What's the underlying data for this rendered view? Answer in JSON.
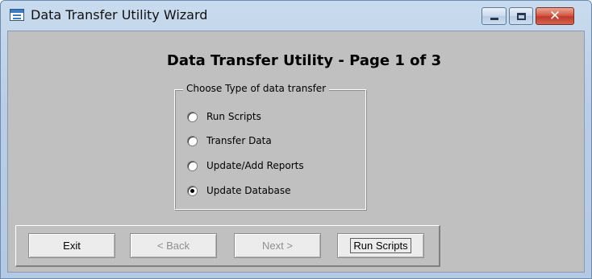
{
  "window": {
    "title": "Data Transfer Utility Wizard",
    "close_symbol": "✕"
  },
  "page": {
    "title": "Data Transfer Utility - Page 1 of 3"
  },
  "group": {
    "legend": "Choose Type of data transfer",
    "options": [
      {
        "label": "Run Scripts",
        "checked": false
      },
      {
        "label": "Transfer Data",
        "checked": false
      },
      {
        "label": "Update/Add Reports",
        "checked": false
      },
      {
        "label": "Update Database",
        "checked": true
      }
    ]
  },
  "buttons": {
    "exit": "Exit",
    "back": "< Back",
    "next": "Next >",
    "run_scripts": "Run Scripts"
  },
  "icons": {
    "app": "app-window-icon",
    "minimize": "minimize-icon",
    "maximize": "maximize-icon",
    "close": "close-icon"
  }
}
